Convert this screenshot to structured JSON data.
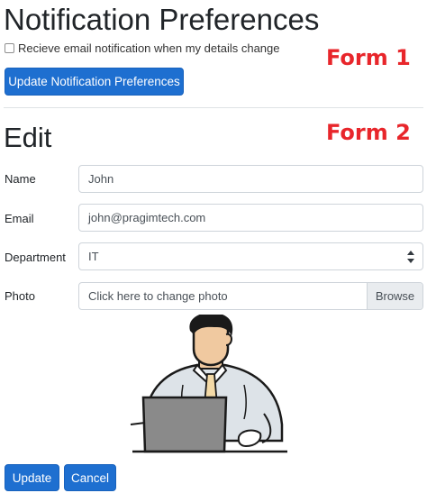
{
  "notification": {
    "title": "Notification Preferences",
    "form_tag": "Form 1",
    "checkbox_label": "Recieve email notification when my details change",
    "checkbox_checked": false,
    "update_button": "Update Notification Preferences"
  },
  "edit": {
    "title": "Edit",
    "form_tag": "Form 2",
    "fields": {
      "name_label": "Name",
      "name_value": "John",
      "email_label": "Email",
      "email_value": "john@pragimtech.com",
      "department_label": "Department",
      "department_value": "IT",
      "photo_label": "Photo",
      "photo_placeholder": "Click here to change photo",
      "browse_label": "Browse"
    },
    "update_button": "Update",
    "cancel_button": "Cancel"
  },
  "colors": {
    "primary": "#1e6fd0",
    "form_tag": "#e8262b"
  }
}
